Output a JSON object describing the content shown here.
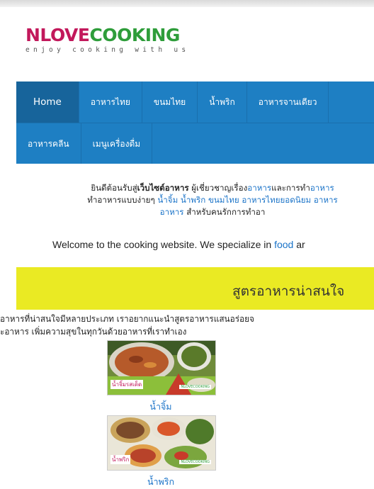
{
  "logo": {
    "part1": "NLOVE",
    "part2": "COOKING",
    "tagline": "enjoy cooking with us"
  },
  "nav": {
    "row1": [
      "Home",
      "อาหารไทย",
      "ขนมไทย",
      "น้ำพริก",
      "อาหารจานเดียว"
    ],
    "row2": [
      "อาหารคลีน",
      "เมนูเครื่องดื่ม"
    ]
  },
  "intro": {
    "l1_a": "ยินดีต้อนรับสู่",
    "l1_b": "เว็บไซต์อาหาร",
    "l1_c": " ผู้เชี่ยวชาญเรื่อง",
    "l1_link1": "อาหาร",
    "l1_d": "และการทำ",
    "l1_link2": "อาหาร",
    "l2_a": "ทำอาหารแบบง่ายๆ ",
    "l2_link1": "น้ำจิ้ม",
    "l2_link2": "น้ำพริก",
    "l2_link3": "ขนมไทย",
    "l2_link4": "อาหารไทยยอดนิยม",
    "l2_link5": "อาหาร",
    "l3_link": "อาหาร",
    "l3_b": " สำหรับคนรักการทำอา"
  },
  "welcome": {
    "text": "Welcome to the cooking website. We specialize in ",
    "link": "food",
    "tail": " ar"
  },
  "banner": {
    "title": "สูตรอาหารน่าสนใจ"
  },
  "desc": {
    "line1": "อาหารที่น่าสนใจมีหลายประเภท เราอยากแนะนำสูตรอาหารแสนอร่อยจ",
    "line2": "ะอาหาร เพิ่มความสุขในทุกวันด้วยอาหารที่เราทำเอง"
  },
  "recipes": [
    {
      "caption": "น้ำจิ้ม",
      "thumb_label": "น้ำจิ้มรสเด็ด",
      "thumb_brand": "NLOVECOOKING"
    },
    {
      "caption": "น้ำพริก",
      "thumb_label": "น้ำพริก",
      "thumb_brand": "NLOVECOOKING"
    }
  ],
  "colors": {
    "nav": "#1e7fc3",
    "banner": "#eaea23",
    "link": "#1a73c8",
    "brand_pink": "#c2185b",
    "brand_green": "#2e9d3a"
  }
}
